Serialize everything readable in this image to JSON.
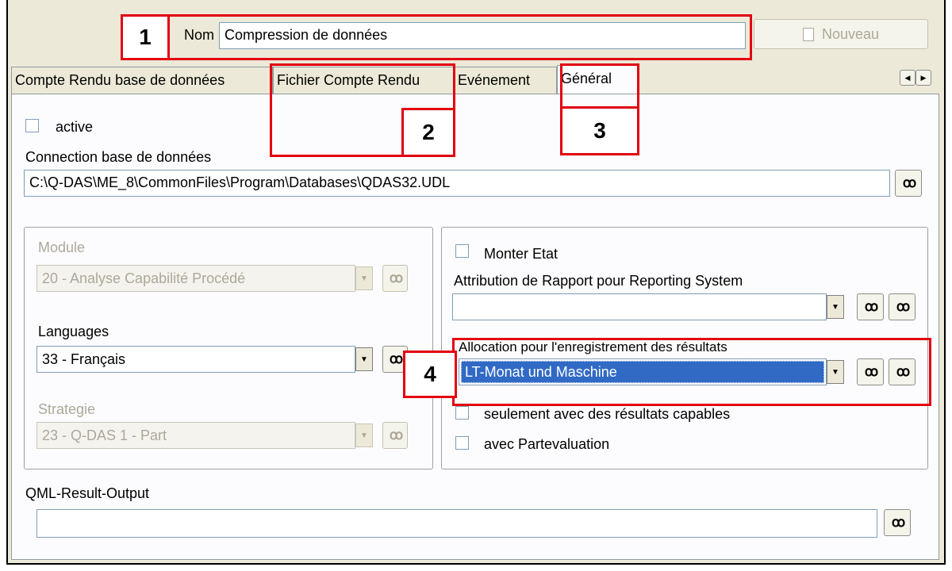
{
  "header": {
    "name_label": "Nom",
    "name_value": "Compression de données",
    "new_button": "Nouveau"
  },
  "tabs": [
    {
      "label": "Compte Rendu base de données"
    },
    {
      "label": "Fichier Compte Rendu"
    },
    {
      "label": "Evénement"
    },
    {
      "label": "Général"
    }
  ],
  "active_tab": "Général",
  "general": {
    "active_label": "active",
    "db_connection_label": "Connection base de données",
    "db_connection_value": "C:\\Q-DAS\\ME_8\\CommonFiles\\Program\\Databases\\QDAS32.UDL",
    "module_label": "Module",
    "module_value": "20 - Analyse Capabilité Procédé",
    "languages_label": "Languages",
    "languages_value": "33 - Français",
    "strategy_label": "Strategie",
    "strategy_value": "23 - Q-DAS 1 - Part",
    "monter_etat_label": "Monter Etat",
    "report_attr_label": "Attribution de Rapport pour Reporting System",
    "report_attr_value": "",
    "allocation_label": "Allocation pour l'enregistrement des résultats",
    "allocation_value": "LT-Monat und Maschine",
    "capable_only_label": "seulement avec des résultats capables",
    "part_eval_label": "avec Partevaluation",
    "qml_label": "QML-Result-Output",
    "qml_value": ""
  },
  "callouts": [
    "1",
    "2",
    "3",
    "4"
  ],
  "icons": {
    "browse": "binoculars-icon",
    "new": "document-icon",
    "dropdown": "triangle-down-icon",
    "scroll_left": "triangle-left-icon",
    "scroll_right": "triangle-right-icon"
  },
  "colors": {
    "callout_red": "#e3000f",
    "selection_blue": "#316ac5",
    "window_bg": "#ece9d8"
  }
}
